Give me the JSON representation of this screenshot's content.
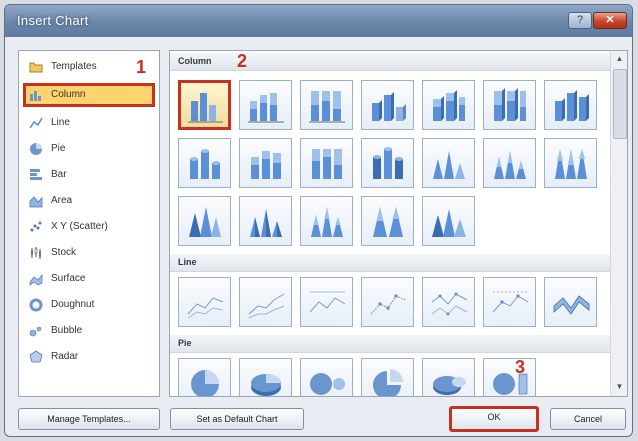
{
  "window": {
    "title": "Insert Chart",
    "help": "?",
    "close": "✕"
  },
  "sidebar": {
    "items": [
      {
        "label": "Templates",
        "icon": "folder-icon"
      },
      {
        "label": "Column",
        "icon": "column-chart-icon",
        "selected": true
      },
      {
        "label": "Line",
        "icon": "line-chart-icon"
      },
      {
        "label": "Pie",
        "icon": "pie-chart-icon"
      },
      {
        "label": "Bar",
        "icon": "bar-chart-icon"
      },
      {
        "label": "Area",
        "icon": "area-chart-icon"
      },
      {
        "label": "X Y (Scatter)",
        "icon": "scatter-chart-icon"
      },
      {
        "label": "Stock",
        "icon": "stock-chart-icon"
      },
      {
        "label": "Surface",
        "icon": "surface-chart-icon"
      },
      {
        "label": "Doughnut",
        "icon": "doughnut-chart-icon"
      },
      {
        "label": "Bubble",
        "icon": "bubble-chart-icon"
      },
      {
        "label": "Radar",
        "icon": "radar-chart-icon"
      }
    ]
  },
  "gallery": {
    "sections": [
      {
        "title": "Column"
      },
      {
        "title": "Line"
      },
      {
        "title": "Pie"
      }
    ]
  },
  "footer": {
    "manage_templates": "Manage Templates...",
    "set_default": "Set as Default Chart",
    "ok": "OK",
    "cancel": "Cancel"
  },
  "annotations": {
    "step1": "1",
    "step2": "2",
    "step3": "3"
  },
  "colors": {
    "highlight": "#c83020",
    "selected_fill": "#ffd46e",
    "chart_blue": "#5b8fd6"
  }
}
